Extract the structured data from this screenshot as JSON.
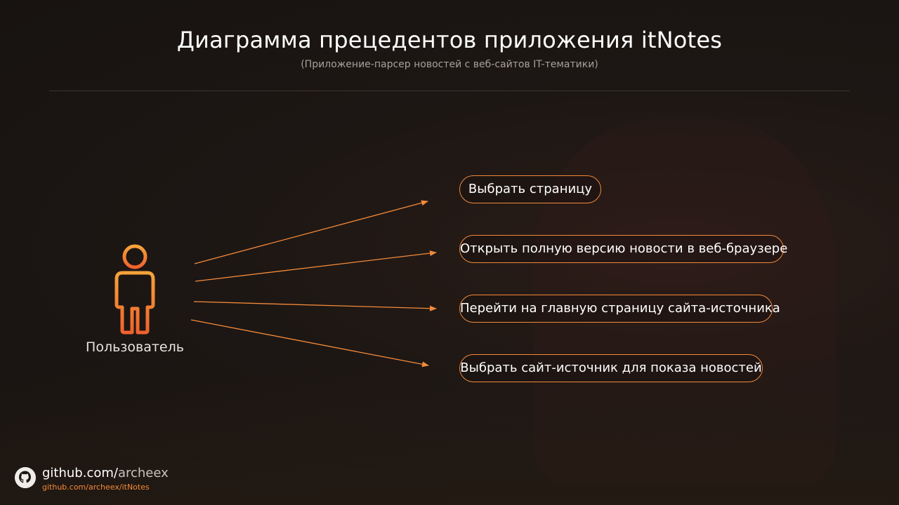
{
  "title": "Диаграмма прецедентов приложения itNotes",
  "subtitle": "(Приложение-парсер новостей с веб-сайтов IT-тематики)",
  "actor": {
    "label": "Пользователь",
    "icon": "person-icon"
  },
  "use_cases": [
    {
      "label": "Выбрать страницу"
    },
    {
      "label": "Открыть полную версию новости в веб-браузере"
    },
    {
      "label": "Перейти на главную страницу сайта-источника"
    },
    {
      "label": "Выбрать сайт-источник для показа новостей"
    }
  ],
  "footer": {
    "host": "github.com/",
    "user": "archeex",
    "link": "github.com/archeex/itNotes",
    "icon": "github-icon"
  },
  "colors": {
    "accent": "#f38a3a",
    "accent_light": "#f6a33a",
    "background": "#1b1714",
    "text": "#ffffff"
  }
}
